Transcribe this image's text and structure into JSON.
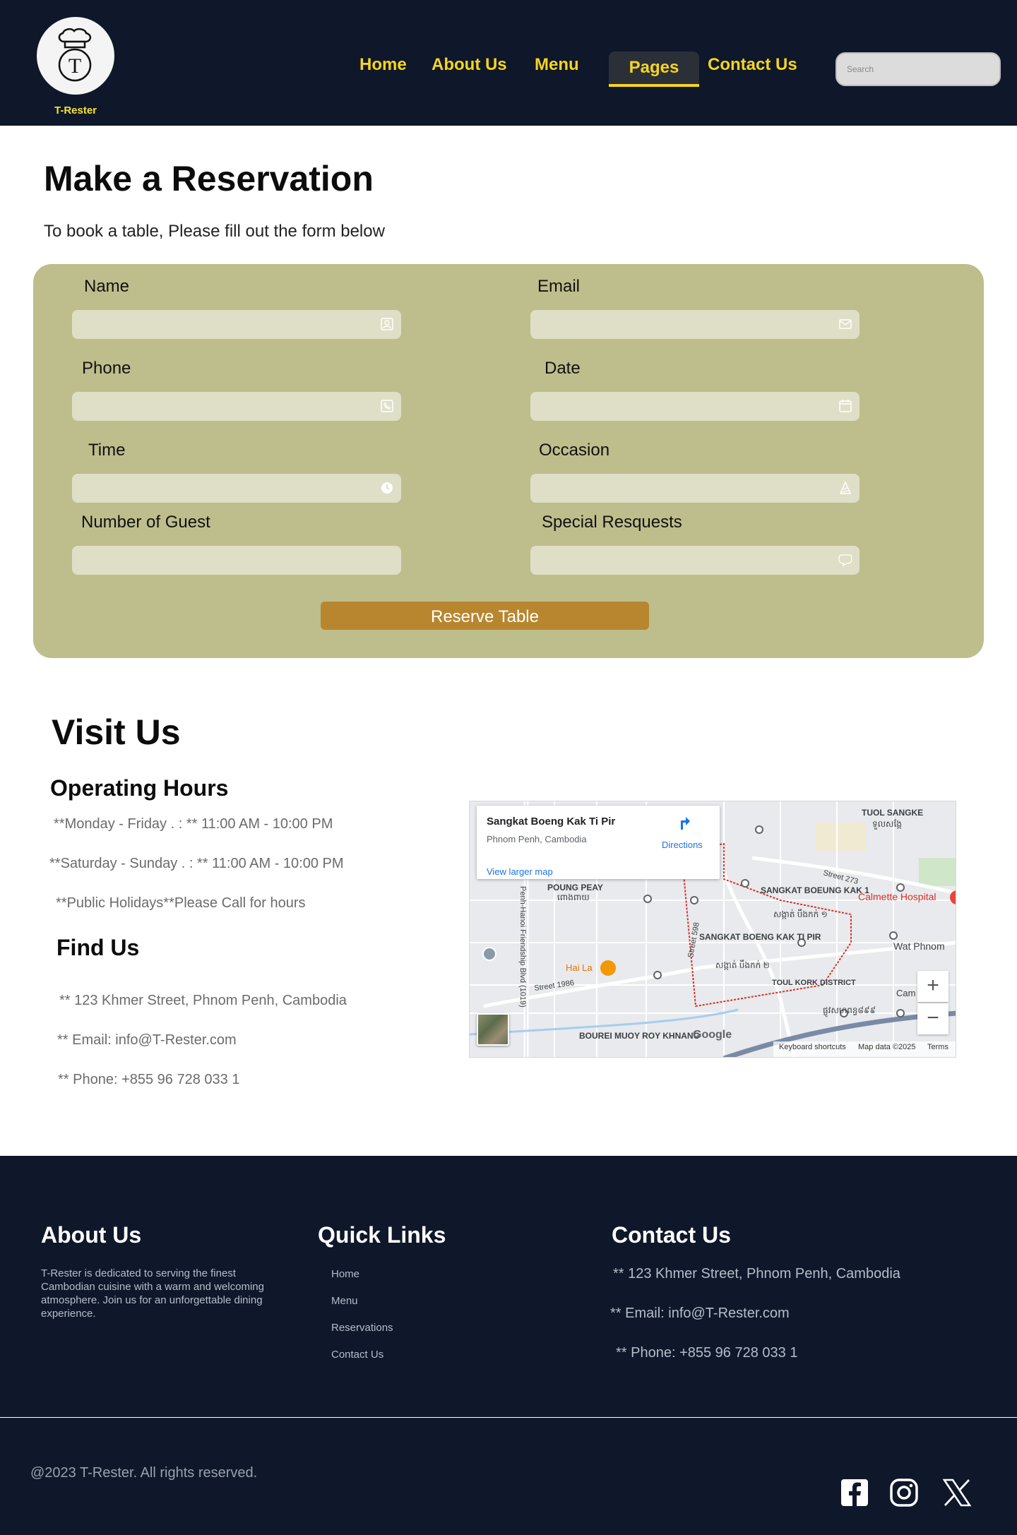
{
  "header": {
    "brand": "T-Rester",
    "logo_letter": "T",
    "nav": {
      "home": "Home",
      "about": "About Us",
      "menu": "Menu",
      "pages": "Pages",
      "contact": "Contact Us"
    },
    "search_placeholder": "Search",
    "colors": {
      "background": "#0f172a",
      "accent": "#f7d51d"
    }
  },
  "reservation": {
    "title": "Make a Reservation",
    "subtitle": "To book a table, Please fill out the form below",
    "fields": {
      "name": {
        "label": "Name",
        "value": "",
        "icon": "user-icon"
      },
      "email": {
        "label": "Email",
        "value": "",
        "icon": "envelope-icon"
      },
      "phone": {
        "label": "Phone",
        "value": "",
        "icon": "phone-icon"
      },
      "date": {
        "label": "Date",
        "value": "",
        "icon": "calendar-icon"
      },
      "time": {
        "label": "Time",
        "value": "",
        "icon": "clock-icon"
      },
      "occasion": {
        "label": "Occasion",
        "value": "",
        "icon": "party-hat-icon"
      },
      "guests": {
        "label": "Number of Guest",
        "value": ""
      },
      "requests": {
        "label": "Special Resquests",
        "value": "",
        "icon": "chat-bubble-icon"
      }
    },
    "submit_label": "Reserve Table",
    "colors": {
      "panel": "#bebd8c",
      "field": "#dfdfc8",
      "button": "#b8862f"
    }
  },
  "visit": {
    "title": "Visit Us",
    "hours_title": "Operating Hours",
    "hours": [
      "**Monday - Friday . : ** 11:00 AM - 10:00 PM",
      "**Saturday - Sunday . : ** 11:00 AM - 10:00 PM",
      "**Public Holidays**Please Call for hours"
    ],
    "find_title": "Find Us",
    "find": [
      "** 123 Khmer Street, Phnom Penh, Cambodia",
      "** Email: info@T-Rester.com",
      "** Phone: +855 96 728 033 1"
    ]
  },
  "map": {
    "place_title": "Sangkat Boeng Kak Ti Pir",
    "place_subtitle": "Phnom Penh, Cambodia",
    "directions_label": "Directions",
    "larger_map_label": "View larger map",
    "zoom_in": "+",
    "zoom_out": "−",
    "labels": {
      "tuol_sangke": "TUOL SANGKE",
      "tuol_sangke_kh": "ទួលសង្កែ",
      "street_273": "Street 273",
      "poung_peay": "POUNG PEAY",
      "poung_peay_kh": "ពោងពាយ",
      "boeung_kak_1": "SANGKAT BOEUNG KAK 1",
      "boeung_kak_1_kh": "សង្កាត់ បឹងកក់ ១",
      "calmette": "Calmette Hospital",
      "boeng_kak_ti_pir": "SANGKAT BOENG KAK TI PIR",
      "boeng_kak_ti_pir_kh": "សង្កាត់ បឹងកក់ ២",
      "wat_phnom": "Wat Phnom",
      "hai_la": "Hai La",
      "street_1986": "Street 1986",
      "street_598": "Street 598",
      "russian_blvd": "Penh-Hanoi Friendship Blvd (1019)",
      "toul_kork": "TOUL KORK DISTRICT",
      "bourei_muoy": "BOUREI MUOY ROY KHNANG",
      "kh_road": "ផ្លូវសហពន្ធ៨៩៩",
      "cam": "Cam"
    },
    "attribution": {
      "google": "Google",
      "shortcuts": "Keyboard shortcuts",
      "map_data": "Map data ©2025",
      "terms": "Terms"
    }
  },
  "footer": {
    "about_title": "About Us",
    "about_text": "T-Rester is dedicated to serving the finest Cambodian cuisine with a warm and welcoming atmosphere. Join us for an unforgettable dining experience.",
    "links_title": "Quick Links",
    "links": [
      "Home",
      "Menu",
      "Reservations",
      "Contact Us"
    ],
    "contact_title": "Contact Us",
    "contact": [
      "** 123 Khmer Street, Phnom Penh, Cambodia",
      "** Email: info@T-Rester.com",
      "** Phone: +855 96 728 033 1"
    ],
    "copyright": "@2023 T-Rester. All rights reserved.",
    "social": [
      "facebook-icon",
      "instagram-icon",
      "x-icon"
    ]
  }
}
